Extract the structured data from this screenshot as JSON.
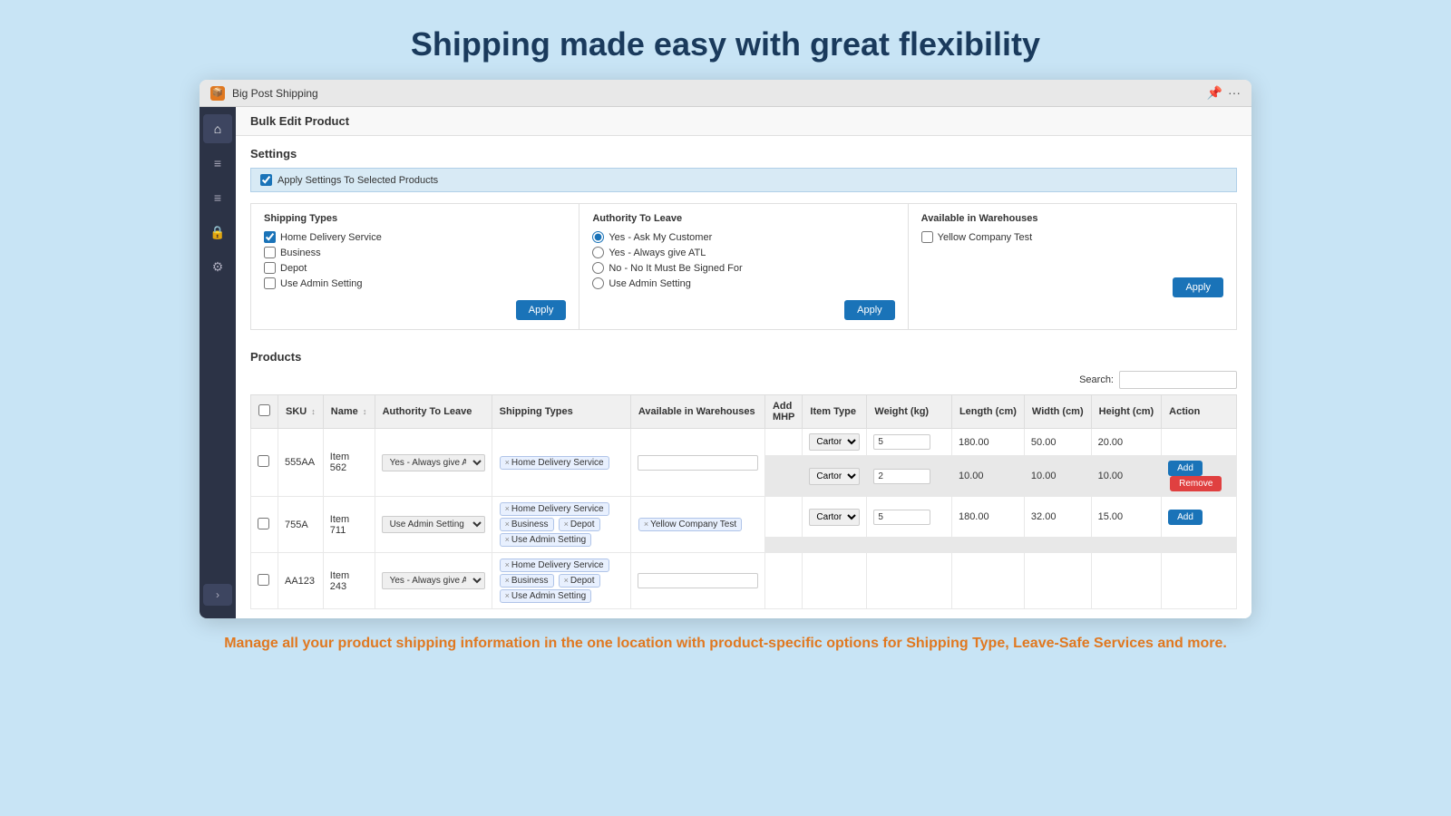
{
  "page": {
    "title": "Shipping made easy with great flexibility",
    "footer_text": "Manage all your product shipping information in the one location with product-specific options for Shipping Type, Leave-Safe Services and more."
  },
  "app": {
    "title": "Big Post Shipping",
    "window_actions": [
      "pin-icon",
      "more-icon"
    ]
  },
  "sidebar": {
    "items": [
      {
        "label": "home",
        "icon": "⌂",
        "active": true
      },
      {
        "label": "list1",
        "icon": "≡",
        "active": false
      },
      {
        "label": "list2",
        "icon": "≡",
        "active": false
      },
      {
        "label": "lock",
        "icon": "🔒",
        "active": false
      },
      {
        "label": "settings",
        "icon": "⚙",
        "active": false
      }
    ],
    "expand_label": "›"
  },
  "bulk_edit": {
    "section_title": "Bulk Edit Product",
    "settings_title": "Settings",
    "apply_settings_label": "Apply Settings To Selected Products",
    "shipping_types": {
      "panel_title": "Shipping Types",
      "options": [
        {
          "label": "Home Delivery Service",
          "checked": true
        },
        {
          "label": "Business",
          "checked": false
        },
        {
          "label": "Depot",
          "checked": false
        },
        {
          "label": "Use Admin Setting",
          "checked": false
        }
      ],
      "apply_label": "Apply"
    },
    "authority_to_leave": {
      "panel_title": "Authority To Leave",
      "options": [
        {
          "label": "Yes - Ask My Customer",
          "selected": true
        },
        {
          "label": "Yes - Always give ATL",
          "selected": false
        },
        {
          "label": "No - No It Must Be Signed For",
          "selected": false
        },
        {
          "label": "Use Admin Setting",
          "selected": false
        }
      ],
      "apply_label": "Apply"
    },
    "available_in_warehouses": {
      "panel_title": "Available in Warehouses",
      "options": [
        {
          "label": "Yellow Company Test",
          "checked": false
        }
      ],
      "apply_label": "Apply"
    }
  },
  "products": {
    "section_title": "Products",
    "search_label": "Search:",
    "columns": [
      "",
      "SKU",
      "Name",
      "Authority To Leave",
      "Shipping Types",
      "Available in Warehouses",
      "Add MHP",
      "Item Type",
      "Weight (kg)",
      "Length (cm)",
      "Width (cm)",
      "Height (cm)",
      "Action"
    ],
    "rows": [
      {
        "id": "555AA",
        "name": "Item 562",
        "atl": "Yes - Always give ATL",
        "shipping_types": [
          "Home Delivery Service"
        ],
        "warehouses": "",
        "mhp_rows": [
          {
            "item_type": "Cartor",
            "weight": "5",
            "length": "180.00",
            "width": "50.00",
            "height": "20.00",
            "action": ""
          },
          {
            "item_type": "Cartor",
            "weight": "2",
            "length": "10.00",
            "width": "10.00",
            "height": "10.00",
            "action": "add_remove"
          }
        ]
      },
      {
        "id": "755A",
        "name": "Item 711",
        "atl": "Use Admin Setting",
        "shipping_types": [
          "Home Delivery Service",
          "Business",
          "Depot",
          "Use Admin Setting"
        ],
        "warehouses": "Yellow Company Test",
        "mhp_rows": [
          {
            "item_type": "Cartor",
            "weight": "5",
            "length": "180.00",
            "width": "32.00",
            "height": "15.00",
            "action": "add"
          }
        ]
      },
      {
        "id": "AA123",
        "name": "Item 243",
        "atl": "Yes - Always give ATL",
        "shipping_types": [
          "Home Delivery Service",
          "Business",
          "Depot",
          "Use Admin Setting"
        ],
        "warehouses": "",
        "mhp_rows": []
      }
    ]
  }
}
